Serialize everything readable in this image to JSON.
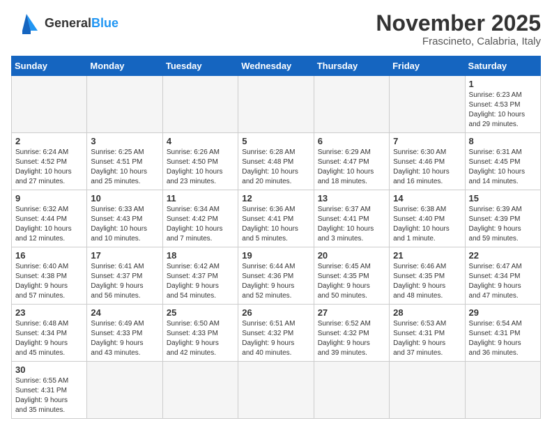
{
  "header": {
    "logo_general": "General",
    "logo_blue": "Blue",
    "month_title": "November 2025",
    "location": "Frascineto, Calabria, Italy"
  },
  "weekdays": [
    "Sunday",
    "Monday",
    "Tuesday",
    "Wednesday",
    "Thursday",
    "Friday",
    "Saturday"
  ],
  "days": [
    {
      "num": "",
      "info": ""
    },
    {
      "num": "",
      "info": ""
    },
    {
      "num": "",
      "info": ""
    },
    {
      "num": "",
      "info": ""
    },
    {
      "num": "",
      "info": ""
    },
    {
      "num": "",
      "info": ""
    },
    {
      "num": "1",
      "info": "Sunrise: 6:23 AM\nSunset: 4:53 PM\nDaylight: 10 hours\nand 29 minutes."
    },
    {
      "num": "2",
      "info": "Sunrise: 6:24 AM\nSunset: 4:52 PM\nDaylight: 10 hours\nand 27 minutes."
    },
    {
      "num": "3",
      "info": "Sunrise: 6:25 AM\nSunset: 4:51 PM\nDaylight: 10 hours\nand 25 minutes."
    },
    {
      "num": "4",
      "info": "Sunrise: 6:26 AM\nSunset: 4:50 PM\nDaylight: 10 hours\nand 23 minutes."
    },
    {
      "num": "5",
      "info": "Sunrise: 6:28 AM\nSunset: 4:48 PM\nDaylight: 10 hours\nand 20 minutes."
    },
    {
      "num": "6",
      "info": "Sunrise: 6:29 AM\nSunset: 4:47 PM\nDaylight: 10 hours\nand 18 minutes."
    },
    {
      "num": "7",
      "info": "Sunrise: 6:30 AM\nSunset: 4:46 PM\nDaylight: 10 hours\nand 16 minutes."
    },
    {
      "num": "8",
      "info": "Sunrise: 6:31 AM\nSunset: 4:45 PM\nDaylight: 10 hours\nand 14 minutes."
    },
    {
      "num": "9",
      "info": "Sunrise: 6:32 AM\nSunset: 4:44 PM\nDaylight: 10 hours\nand 12 minutes."
    },
    {
      "num": "10",
      "info": "Sunrise: 6:33 AM\nSunset: 4:43 PM\nDaylight: 10 hours\nand 10 minutes."
    },
    {
      "num": "11",
      "info": "Sunrise: 6:34 AM\nSunset: 4:42 PM\nDaylight: 10 hours\nand 7 minutes."
    },
    {
      "num": "12",
      "info": "Sunrise: 6:36 AM\nSunset: 4:41 PM\nDaylight: 10 hours\nand 5 minutes."
    },
    {
      "num": "13",
      "info": "Sunrise: 6:37 AM\nSunset: 4:41 PM\nDaylight: 10 hours\nand 3 minutes."
    },
    {
      "num": "14",
      "info": "Sunrise: 6:38 AM\nSunset: 4:40 PM\nDaylight: 10 hours\nand 1 minute."
    },
    {
      "num": "15",
      "info": "Sunrise: 6:39 AM\nSunset: 4:39 PM\nDaylight: 9 hours\nand 59 minutes."
    },
    {
      "num": "16",
      "info": "Sunrise: 6:40 AM\nSunset: 4:38 PM\nDaylight: 9 hours\nand 57 minutes."
    },
    {
      "num": "17",
      "info": "Sunrise: 6:41 AM\nSunset: 4:37 PM\nDaylight: 9 hours\nand 56 minutes."
    },
    {
      "num": "18",
      "info": "Sunrise: 6:42 AM\nSunset: 4:37 PM\nDaylight: 9 hours\nand 54 minutes."
    },
    {
      "num": "19",
      "info": "Sunrise: 6:44 AM\nSunset: 4:36 PM\nDaylight: 9 hours\nand 52 minutes."
    },
    {
      "num": "20",
      "info": "Sunrise: 6:45 AM\nSunset: 4:35 PM\nDaylight: 9 hours\nand 50 minutes."
    },
    {
      "num": "21",
      "info": "Sunrise: 6:46 AM\nSunset: 4:35 PM\nDaylight: 9 hours\nand 48 minutes."
    },
    {
      "num": "22",
      "info": "Sunrise: 6:47 AM\nSunset: 4:34 PM\nDaylight: 9 hours\nand 47 minutes."
    },
    {
      "num": "23",
      "info": "Sunrise: 6:48 AM\nSunset: 4:34 PM\nDaylight: 9 hours\nand 45 minutes."
    },
    {
      "num": "24",
      "info": "Sunrise: 6:49 AM\nSunset: 4:33 PM\nDaylight: 9 hours\nand 43 minutes."
    },
    {
      "num": "25",
      "info": "Sunrise: 6:50 AM\nSunset: 4:33 PM\nDaylight: 9 hours\nand 42 minutes."
    },
    {
      "num": "26",
      "info": "Sunrise: 6:51 AM\nSunset: 4:32 PM\nDaylight: 9 hours\nand 40 minutes."
    },
    {
      "num": "27",
      "info": "Sunrise: 6:52 AM\nSunset: 4:32 PM\nDaylight: 9 hours\nand 39 minutes."
    },
    {
      "num": "28",
      "info": "Sunrise: 6:53 AM\nSunset: 4:31 PM\nDaylight: 9 hours\nand 37 minutes."
    },
    {
      "num": "29",
      "info": "Sunrise: 6:54 AM\nSunset: 4:31 PM\nDaylight: 9 hours\nand 36 minutes."
    },
    {
      "num": "30",
      "info": "Sunrise: 6:55 AM\nSunset: 4:31 PM\nDaylight: 9 hours\nand 35 minutes."
    },
    {
      "num": "",
      "info": ""
    },
    {
      "num": "",
      "info": ""
    },
    {
      "num": "",
      "info": ""
    },
    {
      "num": "",
      "info": ""
    },
    {
      "num": "",
      "info": ""
    },
    {
      "num": "",
      "info": ""
    }
  ]
}
